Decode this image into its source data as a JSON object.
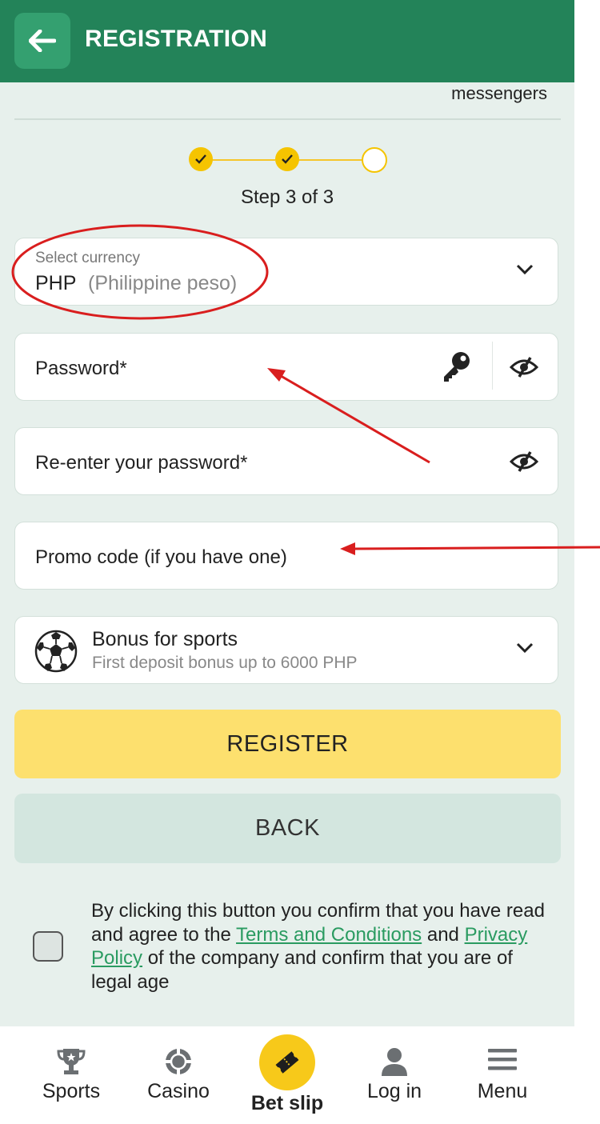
{
  "header": {
    "title": "REGISTRATION"
  },
  "messengers_text": "messengers",
  "stepper": {
    "text": "Step 3 of 3",
    "current": 3,
    "total": 3
  },
  "currency": {
    "label": "Select currency",
    "code": "PHP",
    "name": "(Philippine peso)"
  },
  "password": {
    "label": "Password*"
  },
  "reenter": {
    "label": "Re-enter your password*"
  },
  "promo": {
    "label": "Promo code (if you have one)"
  },
  "bonus": {
    "title": "Bonus for sports",
    "subtitle": "First deposit bonus up to 6000 PHP"
  },
  "buttons": {
    "register": "REGISTER",
    "back": "BACK"
  },
  "consent": {
    "text1": "By clicking this button you confirm that you have read and agree to the ",
    "terms_link": "Terms and Conditions",
    "text2": " and ",
    "privacy_link": "Privacy Policy",
    "text3": " of the company and confirm that you are of legal age"
  },
  "nav": {
    "sports": "Sports",
    "casino": "Casino",
    "betslip": "Bet slip",
    "login": "Log in",
    "menu": "Menu"
  },
  "colors": {
    "header": "#238359",
    "accent": "#f5c400",
    "register": "#fde06e",
    "annotation": "#d91e1e"
  }
}
